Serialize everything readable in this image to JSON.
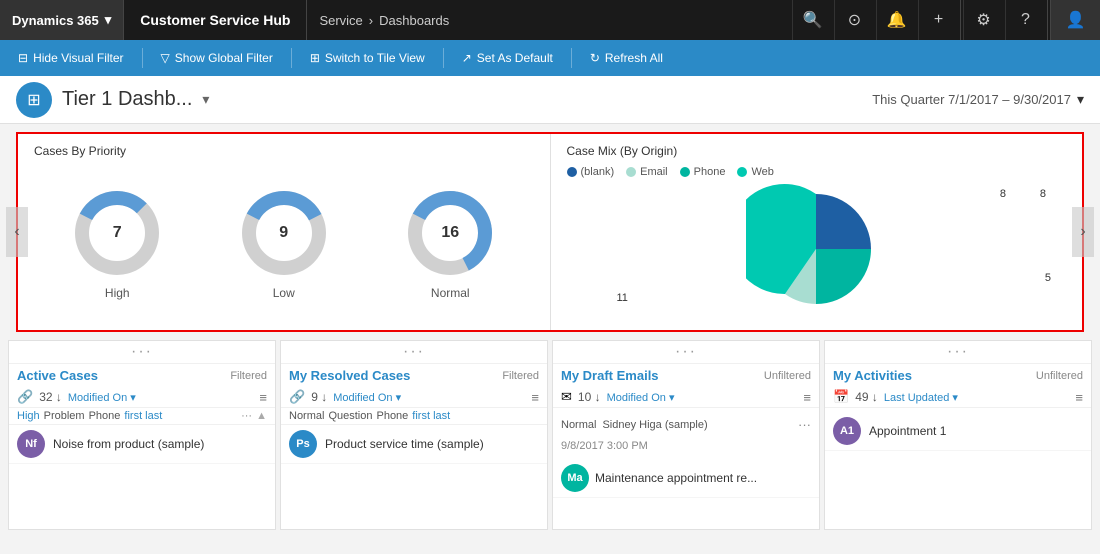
{
  "topNav": {
    "dynamics365": "Dynamics 365",
    "dropdown_icon": "▾",
    "title": "Customer Service Hub",
    "breadcrumb_service": "Service",
    "breadcrumb_separator": "›",
    "breadcrumb_dashboards": "Dashboards",
    "icons": {
      "search": "🔍",
      "target": "⊙",
      "bell": "🔔",
      "plus": "+",
      "settings": "⚙",
      "question": "?",
      "user": "👤"
    }
  },
  "toolbar": {
    "hide_visual_filter": "Hide Visual Filter",
    "show_global_filter": "Show Global Filter",
    "switch_to_tile_view": "Switch to Tile View",
    "set_as_default": "Set As Default",
    "refresh_all": "Refresh All"
  },
  "dashboard": {
    "icon": "⊞",
    "title": "Tier 1 Dashb...",
    "date_range": "This Quarter 7/1/2017 – 9/30/2017"
  },
  "charts": {
    "left_title": "Cases By Priority",
    "donuts": [
      {
        "label": "High",
        "value": 7,
        "pct_blue": 0.3,
        "pct_gray": 0.7
      },
      {
        "label": "Low",
        "value": 9,
        "pct_blue": 0.35,
        "pct_gray": 0.65
      },
      {
        "label": "Normal",
        "value": 16,
        "pct_blue": 0.6,
        "pct_gray": 0.4
      }
    ],
    "right_title": "Case Mix (By Origin)",
    "legend": [
      {
        "label": "(blank)",
        "color": "#1e5fa3"
      },
      {
        "label": "Email",
        "color": "#a8ddd1"
      },
      {
        "label": "Phone",
        "color": "#00b5a0"
      },
      {
        "label": "Web",
        "color": "#00c9b1"
      }
    ],
    "pie_data": [
      {
        "label": "8",
        "color": "#1e5fa3",
        "value": 8,
        "startAngle": 0,
        "endAngle": 100
      },
      {
        "label": "8",
        "color": "#00b5a0",
        "value": 8,
        "startAngle": 100,
        "endAngle": 200
      },
      {
        "label": "5",
        "color": "#a8ddd1",
        "value": 5,
        "startAngle": 200,
        "endAngle": 263
      },
      {
        "label": "11",
        "color": "#00c9b1",
        "value": 11,
        "startAngle": 263,
        "endAngle": 360
      }
    ]
  },
  "cards": [
    {
      "title": "Active Cases",
      "status": "Filtered",
      "count": 32,
      "sort": "Modified On",
      "filters": [
        "High",
        "Problem",
        "Phone",
        "first last"
      ],
      "items": [
        {
          "initials": "Nf",
          "color": "#7b5ea7",
          "text": "Noise from product (sample)"
        }
      ]
    },
    {
      "title": "My Resolved Cases",
      "status": "Filtered",
      "count": 9,
      "sort": "Modified On",
      "filters": [
        "Normal",
        "Question",
        "Phone",
        "first last"
      ],
      "items": [
        {
          "initials": "Ps",
          "color": "#2b8ac7",
          "text": "Product service time (sample)"
        }
      ]
    },
    {
      "title": "My Draft Emails",
      "status": "Unfiltered",
      "count": 10,
      "sort": "Modified On",
      "filters": [],
      "items": [
        {
          "initials": "Ma",
          "color": "#00b5a0",
          "text": "Maintenance appointment re..."
        }
      ],
      "extra": "Normal  Sidney Higa (sample)\n9/8/2017 3:00 PM"
    },
    {
      "title": "My Activities",
      "status": "Unfiltered",
      "count": 49,
      "sort": "Last Updated",
      "filters": [],
      "items": [
        {
          "initials": "A1",
          "color": "#7b5ea7",
          "text": "Appointment 1"
        }
      ]
    }
  ]
}
